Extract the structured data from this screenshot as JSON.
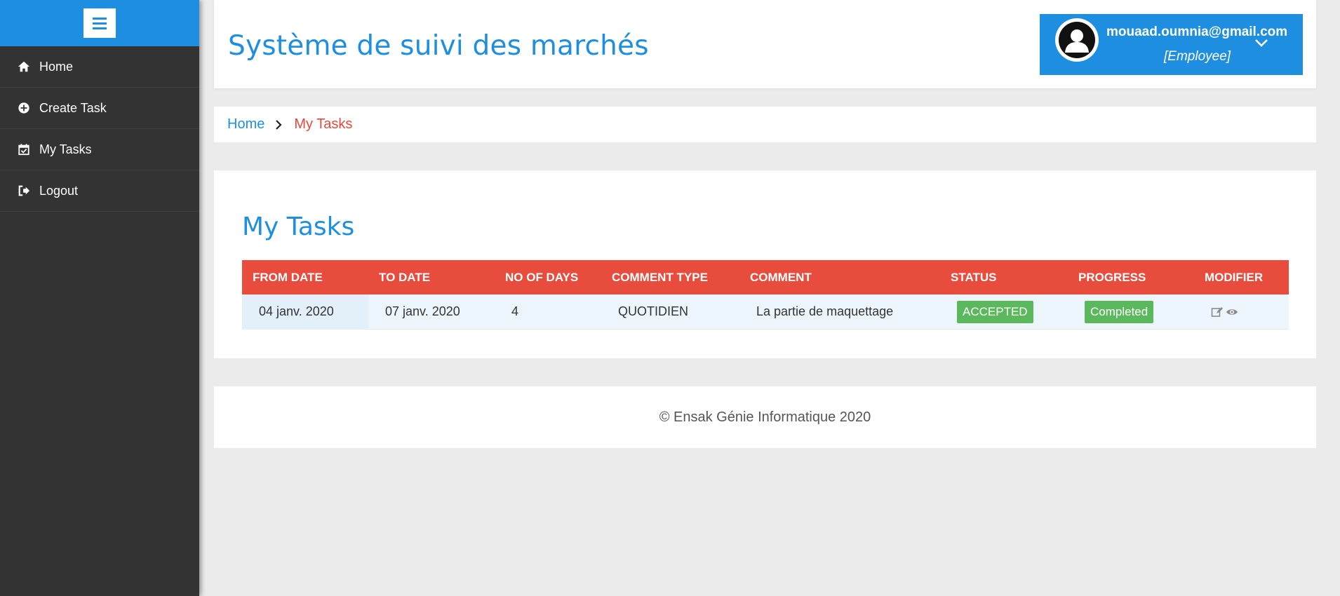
{
  "app": {
    "title": "Système de suivi des marchés",
    "accent_color": "#1e8fe0",
    "header_color": "#e84c3d"
  },
  "sidebar": {
    "toggle_icon": "hamburger-menu-icon",
    "items": [
      {
        "label": "Home",
        "icon": "home-icon"
      },
      {
        "label": "Create Task",
        "icon": "plus-circle-icon"
      },
      {
        "label": "My Tasks",
        "icon": "calendar-check-icon"
      },
      {
        "label": "Logout",
        "icon": "sign-out-icon"
      }
    ]
  },
  "user": {
    "email": "mouaad.oumnia@gmail.com",
    "role": "[Employee]",
    "avatar_icon": "user-avatar-icon",
    "dropdown_icon": "chevron-down-icon"
  },
  "breadcrumb": {
    "home": "Home",
    "current": "My Tasks"
  },
  "main": {
    "title": "My Tasks",
    "table": {
      "headers": [
        "FROM DATE",
        "TO DATE",
        "NO OF DAYS",
        "COMMENT TYPE",
        "COMMENT",
        "STATUS",
        "PROGRESS",
        "MODIFIER"
      ],
      "rows": [
        {
          "from_date": "04 janv. 2020",
          "to_date": "07 janv. 2020",
          "days": "4",
          "comment_type": "QUOTIDIEN",
          "comment": "La partie de maquettage",
          "status": "ACCEPTED",
          "progress": "Completed",
          "status_color": "#5cb85c",
          "actions": [
            "edit-icon",
            "eye-icon"
          ]
        }
      ]
    }
  },
  "footer": {
    "text": "© Ensak Génie Informatique 2020"
  }
}
